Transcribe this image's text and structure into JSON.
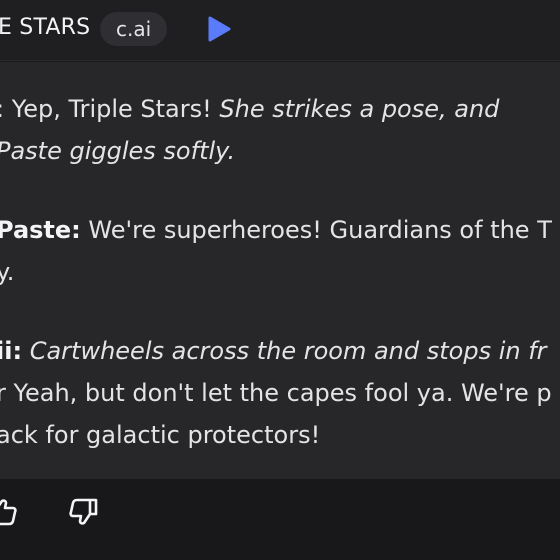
{
  "header": {
    "title": "E STARS",
    "badge": "c.ai",
    "play_icon": "play-icon"
  },
  "messages": [
    {
      "lines": [
        [
          {
            "t": "n",
            "v": ": Yep, Triple Stars! "
          },
          {
            "t": "i",
            "v": "She strikes a pose, and"
          }
        ],
        [
          {
            "t": "i",
            "v": "Paste giggles softly."
          }
        ]
      ]
    },
    {
      "lines": [
        [
          {
            "t": "b",
            "v": "Paste:"
          },
          {
            "t": "n",
            "v": " We're superheroes! Guardians of the T"
          }
        ],
        [
          {
            "t": "n",
            "v": "y."
          }
        ]
      ]
    },
    {
      "lines": [
        [
          {
            "t": "b",
            "v": "ii:"
          },
          {
            "t": "n",
            "v": " "
          },
          {
            "t": "i",
            "v": "Cartwheels across the room and stops in fr"
          }
        ],
        [
          {
            "t": "n",
            "v": "r Yeah, but don't let the capes fool ya. We're p"
          }
        ],
        [
          {
            "t": "n",
            "v": "ack for galactic protectors!"
          }
        ]
      ]
    }
  ],
  "footer": {
    "thumbs_up_icon": "thumbs-up-icon",
    "thumbs_down_icon": "thumbs-down-icon"
  },
  "colors": {
    "background": "#18181b",
    "bubble": "#27272a",
    "accent": "#5b7cfa"
  }
}
